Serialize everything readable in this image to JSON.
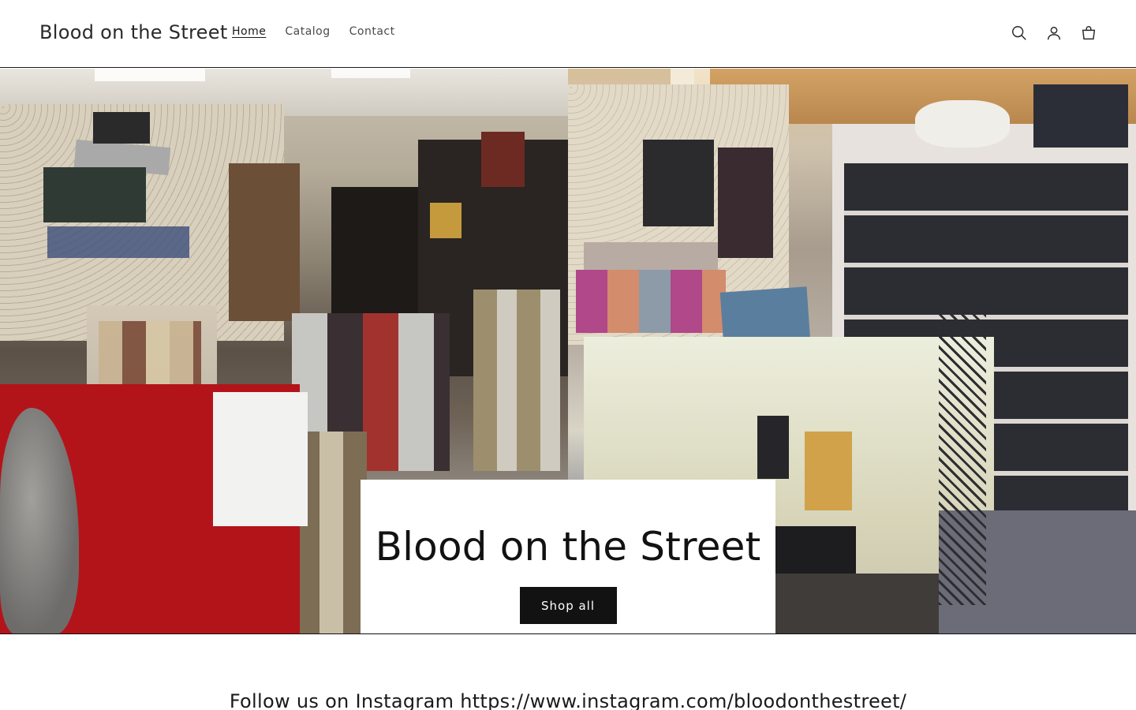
{
  "header": {
    "logo": "Blood on the Street",
    "nav": [
      {
        "label": "Home",
        "active": true
      },
      {
        "label": "Catalog",
        "active": false
      },
      {
        "label": "Contact",
        "active": false
      }
    ],
    "icons": [
      "search-icon",
      "account-icon",
      "cart-icon"
    ]
  },
  "hero": {
    "title": "Blood on the Street",
    "button_label": "Shop all",
    "images": [
      "store-interior-comics",
      "store-interior-display-case"
    ]
  },
  "follow": {
    "text": "Follow us on Instagram https://www.instagram.com/bloodonthestreet/"
  },
  "colors": {
    "text": "#121212",
    "button_bg": "#121212",
    "button_text": "#ffffff",
    "background": "#ffffff"
  }
}
